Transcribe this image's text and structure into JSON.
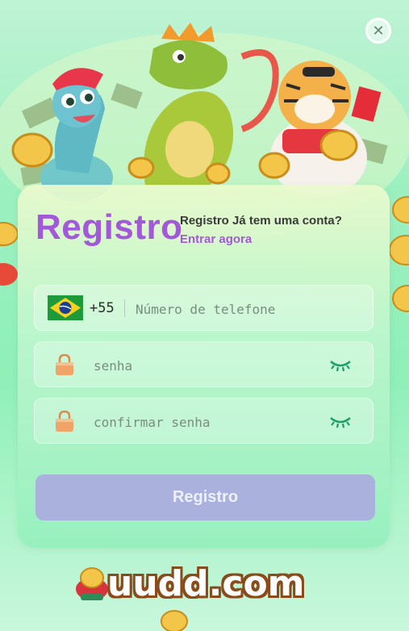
{
  "dialog": {
    "close_label": "✕"
  },
  "register": {
    "title": "Registro",
    "have_account_text": "Registro Já tem uma conta?",
    "login_link": "Entrar agora",
    "phone": {
      "country_code": "+55",
      "placeholder": "Número de telefone",
      "value": ""
    },
    "password": {
      "placeholder": "senha",
      "value": ""
    },
    "confirm_password": {
      "placeholder": "confirmar senha",
      "value": ""
    },
    "submit_label": "Registro"
  },
  "footer": {
    "brand": "uudd.com"
  },
  "colors": {
    "accent_purple": "#a259d9",
    "button_bg": "#a9b1dc",
    "eye_green": "#1a9e6a"
  },
  "icons": [
    "brazil-flag-icon",
    "lock-icon",
    "eye-closed-icon",
    "close-icon"
  ]
}
